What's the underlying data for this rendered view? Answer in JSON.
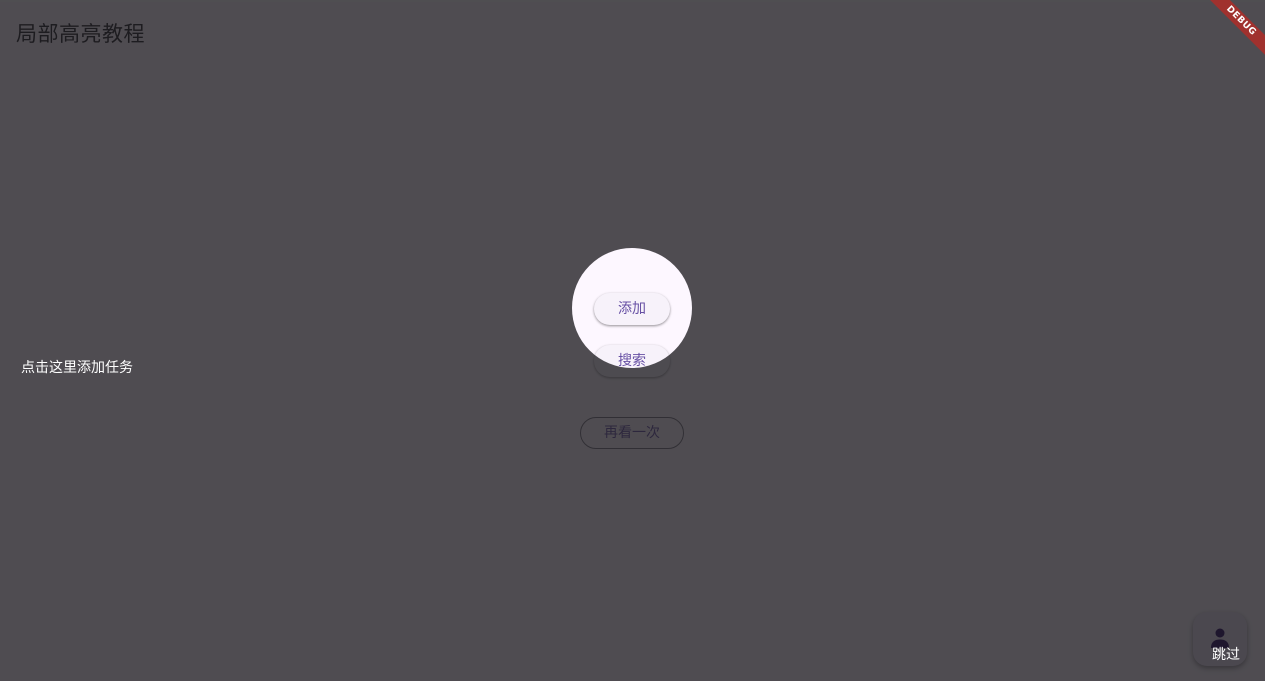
{
  "app_bar": {
    "title": "局部高亮教程"
  },
  "buttons": {
    "add_label": "添加",
    "search_label": "搜索",
    "replay_label": "再看一次"
  },
  "fab": {
    "icon": "person-icon"
  },
  "guide": {
    "tip_text": "点击这里添加任务",
    "skip_label": "跳过"
  },
  "debug_banner": {
    "label": "DEBUG"
  },
  "colors": {
    "primary": "#6750a4",
    "background": "#fdf7ff",
    "overlay": "#4f4c50",
    "debug_banner": "#a0312e"
  }
}
